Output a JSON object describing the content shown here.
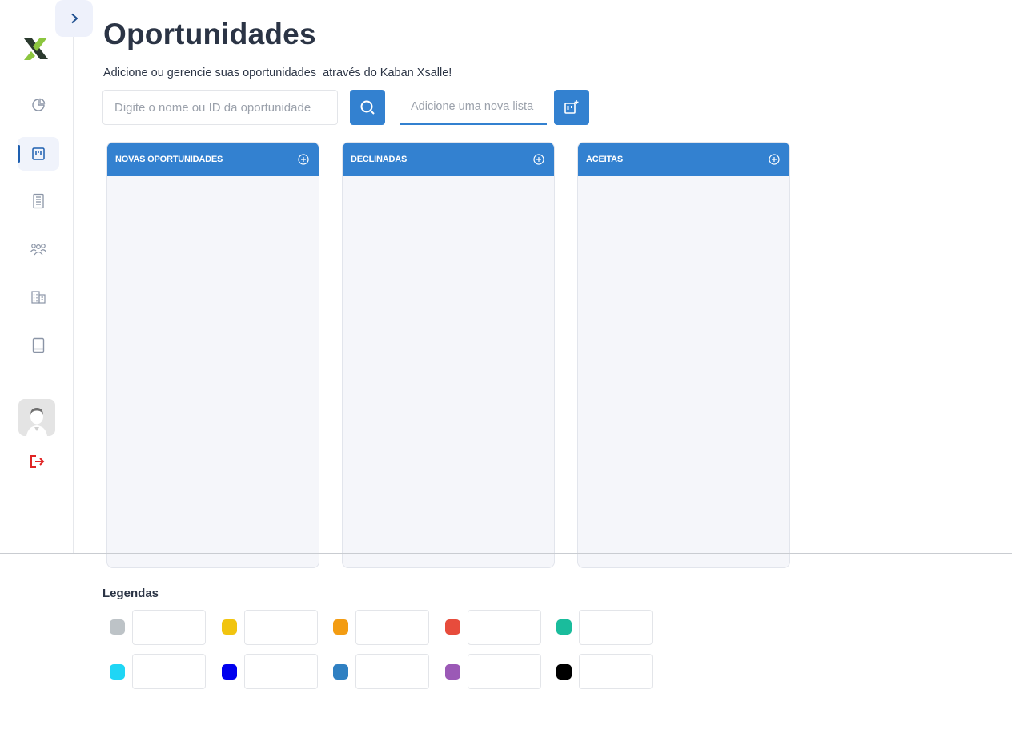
{
  "sidebar": {
    "logo": "xsalle-logo",
    "collapse_icon": "chevron-right-icon",
    "items": [
      {
        "icon": "pie-chart-icon",
        "active": false
      },
      {
        "icon": "kanban-board-icon",
        "active": true
      },
      {
        "icon": "document-list-icon",
        "active": false
      },
      {
        "icon": "users-group-icon",
        "active": false
      },
      {
        "icon": "building-icon",
        "active": false
      },
      {
        "icon": "book-icon",
        "active": false
      }
    ],
    "avatar": "user-avatar",
    "logout_icon": "logout-icon"
  },
  "header": {
    "title": "Oportunidades",
    "subtitle": "Adicione ou gerencie suas oportunidades  através do Kaban Xsalle!"
  },
  "search": {
    "placeholder": "Digite o nome ou ID da oportunidade",
    "value": "",
    "button_icon": "search-icon"
  },
  "new_list": {
    "placeholder": "Adicione uma nova lista",
    "value": "",
    "button_icon": "add-board-icon"
  },
  "columns": [
    {
      "title": "NOVAS OPORTUNIDADES",
      "add_icon": "plus-circle-icon"
    },
    {
      "title": "DECLINADAS",
      "add_icon": "plus-circle-icon"
    },
    {
      "title": "ACEITAS",
      "add_icon": "plus-circle-icon"
    }
  ],
  "legend": {
    "title": "Legendas",
    "items": [
      {
        "color": "#bdc3c7",
        "value": ""
      },
      {
        "color": "#f1c40f",
        "value": ""
      },
      {
        "color": "#f39c12",
        "value": ""
      },
      {
        "color": "#e74c3c",
        "value": ""
      },
      {
        "color": "#1abc9c",
        "value": ""
      },
      {
        "color": "#1fd6f5",
        "value": ""
      },
      {
        "color": "#0000ee",
        "value": ""
      },
      {
        "color": "#2f80c2",
        "value": ""
      },
      {
        "color": "#9b59b6",
        "value": ""
      },
      {
        "color": "#000000",
        "value": ""
      }
    ]
  },
  "colors": {
    "primary": "#3381d0",
    "nav_active": "#1e5fb0",
    "logout": "#e02424",
    "logo_green": "#8cc63f",
    "logo_dark": "#2b3a2e"
  }
}
